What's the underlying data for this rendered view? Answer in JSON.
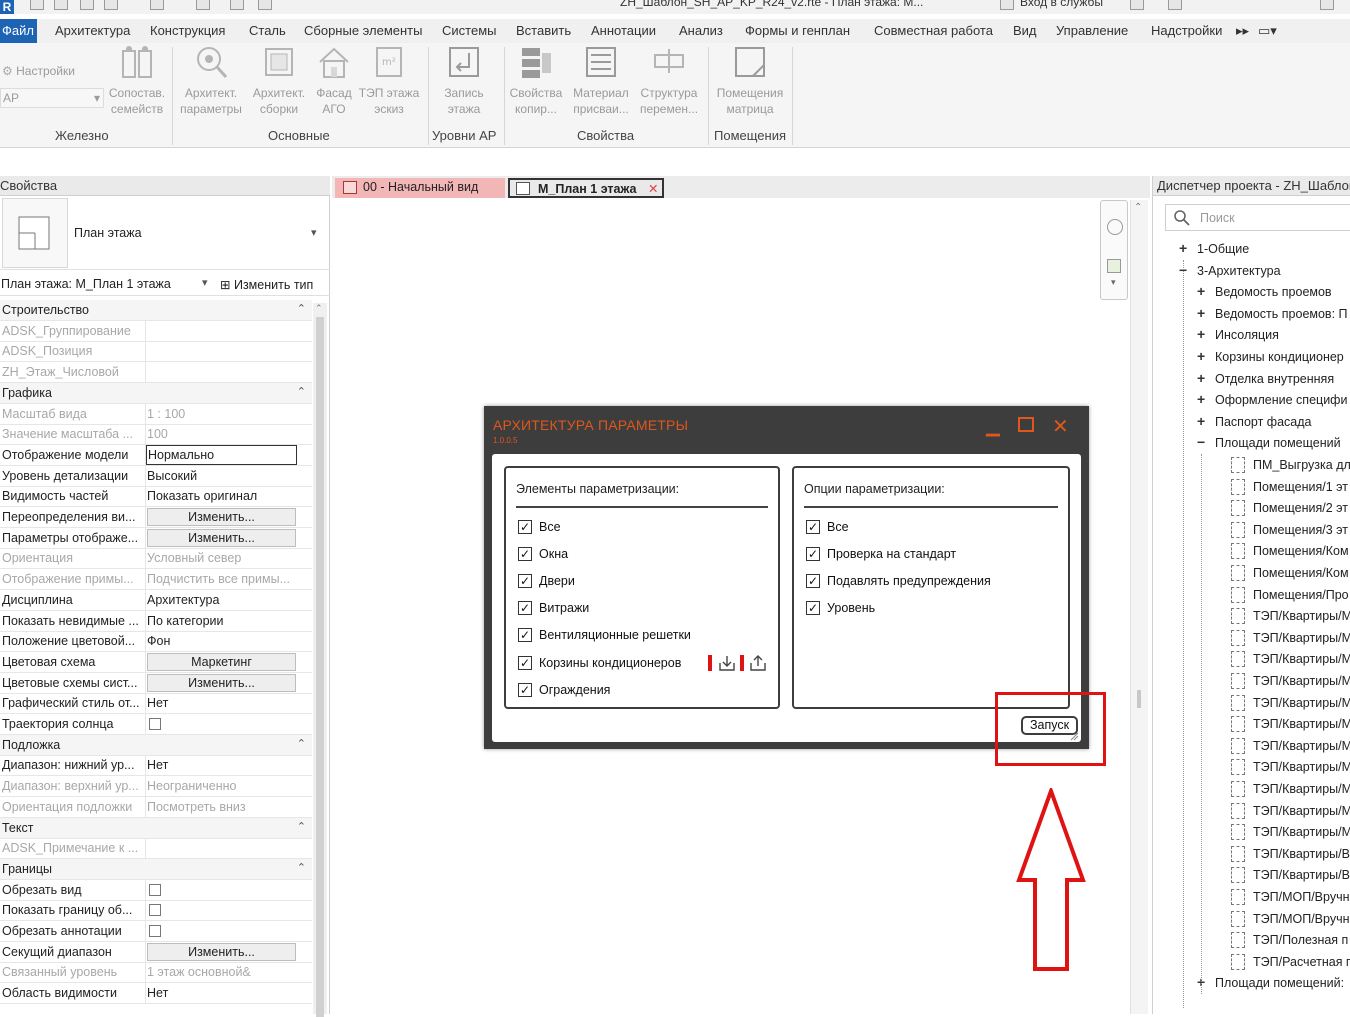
{
  "titlebar": {
    "app_letter": "R",
    "file_title": "ZH_Шаблон_SH_AP_KP_R24_v2.rte - План этажа: M...",
    "signin": "Вход в службы"
  },
  "menubar": {
    "file_label": "Файл",
    "items": [
      "Архитектура",
      "Конструкция",
      "Сталь",
      "Сборные элементы",
      "Системы",
      "Вставить",
      "Аннотации",
      "Анализ",
      "Формы и генплан",
      "Совместная работа",
      "Вид",
      "Управление",
      "Надстройки"
    ]
  },
  "ribbon": {
    "settings_label": "Настройки",
    "dropdown_value": "АР",
    "buttons": [
      {
        "line1": "Сопостав.",
        "line2": "семейств",
        "icon": "family-compare-icon"
      },
      {
        "line1": "Архитект.",
        "line2": "параметры",
        "icon": "arch-params-icon"
      },
      {
        "line1": "Архитект.",
        "line2": "сборки",
        "icon": "arch-assembly-icon"
      },
      {
        "line1": "Фасад",
        "line2": "АГО",
        "icon": "facade-icon"
      },
      {
        "line1": "ТЭП этажа",
        "line2": "эскиз",
        "icon": "tep-icon"
      },
      {
        "line1": "Запись",
        "line2": "этажа",
        "icon": "level-record-icon"
      },
      {
        "line1": "Свойства",
        "line2": "копир...",
        "icon": "properties-copy-icon"
      },
      {
        "line1": "Материал",
        "line2": "присваи...",
        "icon": "material-icon"
      },
      {
        "line1": "Структура",
        "line2": "перемен...",
        "icon": "structure-icon"
      },
      {
        "line1": "Помещения",
        "line2": "матрица",
        "icon": "rooms-matrix-icon"
      }
    ],
    "panels": [
      "Железно",
      "Основные",
      "Уровни АР",
      "Свойства",
      "Помещения"
    ]
  },
  "properties": {
    "title": "Свойства",
    "type_name": "План этажа",
    "instance_label": "План этажа: М_План 1 этажа",
    "edit_type_label": "Изменить тип",
    "rows": [
      {
        "kind": "group",
        "name": "Строительство"
      },
      {
        "kind": "dim",
        "name": "ADSK_Группирование",
        "value": ""
      },
      {
        "kind": "dim",
        "name": "ADSK_Позиция",
        "value": ""
      },
      {
        "kind": "dim",
        "name": "ZH_Этаж_Числовой",
        "value": ""
      },
      {
        "kind": "group",
        "name": "Графика"
      },
      {
        "kind": "dim",
        "name": "Масштаб вида",
        "value": "1 : 100"
      },
      {
        "kind": "dim",
        "name": "Значение масштаба ...",
        "value": "100"
      },
      {
        "kind": "input",
        "name": "Отображение модели",
        "value": "Нормально"
      },
      {
        "kind": "text",
        "name": "Уровень детализации",
        "value": "Высокий"
      },
      {
        "kind": "text",
        "name": "Видимость частей",
        "value": "Показать оригинал"
      },
      {
        "kind": "button",
        "name": "Переопределения ви...",
        "value": "Изменить..."
      },
      {
        "kind": "button",
        "name": "Параметры отображе...",
        "value": "Изменить..."
      },
      {
        "kind": "dim",
        "name": "Ориентация",
        "value": "Условный север"
      },
      {
        "kind": "dim",
        "name": "Отображение примы...",
        "value": "Подчистить все примы..."
      },
      {
        "kind": "text",
        "name": "Дисциплина",
        "value": "Архитектура"
      },
      {
        "kind": "text",
        "name": "Показать невидимые ...",
        "value": "По категории"
      },
      {
        "kind": "text",
        "name": "Положение цветовой...",
        "value": "Фон"
      },
      {
        "kind": "button",
        "name": "Цветовая схема",
        "value": "Маркетинг"
      },
      {
        "kind": "button",
        "name": "Цветовые схемы сист...",
        "value": "Изменить..."
      },
      {
        "kind": "text",
        "name": "Графический стиль от...",
        "value": "Нет"
      },
      {
        "kind": "check",
        "name": "Траектория солнца",
        "value": ""
      },
      {
        "kind": "group",
        "name": "Подложка"
      },
      {
        "kind": "text",
        "name": "Диапазон: нижний ур...",
        "value": "Нет"
      },
      {
        "kind": "dim",
        "name": "Диапазон: верхний ур...",
        "value": "Неограниченно"
      },
      {
        "kind": "dim",
        "name": "Ориентация подложки",
        "value": "Посмотреть вниз"
      },
      {
        "kind": "group",
        "name": "Текст"
      },
      {
        "kind": "dim",
        "name": "ADSK_Примечание к ...",
        "value": ""
      },
      {
        "kind": "group",
        "name": "Границы"
      },
      {
        "kind": "check",
        "name": "Обрезать вид",
        "value": ""
      },
      {
        "kind": "check",
        "name": "Показать границу об...",
        "value": ""
      },
      {
        "kind": "check",
        "name": "Обрезать аннотации",
        "value": ""
      },
      {
        "kind": "button",
        "name": "Секущий диапазон",
        "value": "Изменить..."
      },
      {
        "kind": "dim",
        "name": "Связанный уровень",
        "value": "1 этаж основной&"
      },
      {
        "kind": "text",
        "name": "Область видимости",
        "value": "Нет"
      }
    ]
  },
  "tabs": [
    {
      "label": "00 - Начальный вид",
      "active": false
    },
    {
      "label": "М_План 1 этажа",
      "active": true
    }
  ],
  "browser": {
    "title": "Диспетчер проекта - ZH_Шаблон",
    "search_placeholder": "Поиск",
    "tree": [
      {
        "level": 0,
        "sign": "+",
        "label": "1-Общие"
      },
      {
        "level": 0,
        "sign": "−",
        "label": "3-Архитектура"
      },
      {
        "level": 1,
        "sign": "+",
        "label": "Ведомость проемов"
      },
      {
        "level": 1,
        "sign": "+",
        "label": "Ведомость проемов: П"
      },
      {
        "level": 1,
        "sign": "+",
        "label": "Инсоляция"
      },
      {
        "level": 1,
        "sign": "+",
        "label": "Корзины кондиционер"
      },
      {
        "level": 1,
        "sign": "+",
        "label": "Отделка внутренняя"
      },
      {
        "level": 1,
        "sign": "+",
        "label": "Оформление специфи"
      },
      {
        "level": 1,
        "sign": "+",
        "label": "Паспорт фасада"
      },
      {
        "level": 1,
        "sign": "−",
        "label": "Площади помещений"
      },
      {
        "level": 2,
        "sign": "",
        "label": "ПМ_Выгрузка дл"
      },
      {
        "level": 2,
        "sign": "",
        "label": "Помещения/1 эт"
      },
      {
        "level": 2,
        "sign": "",
        "label": "Помещения/2 эт"
      },
      {
        "level": 2,
        "sign": "",
        "label": "Помещения/3 эт"
      },
      {
        "level": 2,
        "sign": "",
        "label": "Помещения/Ком"
      },
      {
        "level": 2,
        "sign": "",
        "label": "Помещения/Ком"
      },
      {
        "level": 2,
        "sign": "",
        "label": "Помещения/Про"
      },
      {
        "level": 2,
        "sign": "",
        "label": "ТЭП/Квартиры/М"
      },
      {
        "level": 2,
        "sign": "",
        "label": "ТЭП/Квартиры/М"
      },
      {
        "level": 2,
        "sign": "",
        "label": "ТЭП/Квартиры/М"
      },
      {
        "level": 2,
        "sign": "",
        "label": "ТЭП/Квартиры/М"
      },
      {
        "level": 2,
        "sign": "",
        "label": "ТЭП/Квартиры/М"
      },
      {
        "level": 2,
        "sign": "",
        "label": "ТЭП/Квартиры/М"
      },
      {
        "level": 2,
        "sign": "",
        "label": "ТЭП/Квартиры/М"
      },
      {
        "level": 2,
        "sign": "",
        "label": "ТЭП/Квартиры/М"
      },
      {
        "level": 2,
        "sign": "",
        "label": "ТЭП/Квартиры/М"
      },
      {
        "level": 2,
        "sign": "",
        "label": "ТЭП/Квартиры/М"
      },
      {
        "level": 2,
        "sign": "",
        "label": "ТЭП/Квартиры/М"
      },
      {
        "level": 2,
        "sign": "",
        "label": "ТЭП/Квартиры/В"
      },
      {
        "level": 2,
        "sign": "",
        "label": "ТЭП/Квартиры/В"
      },
      {
        "level": 2,
        "sign": "",
        "label": "ТЭП/МОП/Вручн"
      },
      {
        "level": 2,
        "sign": "",
        "label": "ТЭП/МОП/Вручн"
      },
      {
        "level": 2,
        "sign": "",
        "label": "ТЭП/Полезная п"
      },
      {
        "level": 2,
        "sign": "",
        "label": "ТЭП/Расчетная п"
      },
      {
        "level": 1,
        "sign": "+",
        "label": "Площади помещений:"
      }
    ]
  },
  "dialog": {
    "title": "АРХИТЕКТУРА ПАРАМЕТРЫ",
    "version": "1.0.0.5",
    "left_group": {
      "title": "Элементы параметризации:",
      "items": [
        "Все",
        "Окна",
        "Двери",
        "Витражи",
        "Вентиляционные решетки",
        "Корзины кондиционеров",
        "Ограждения"
      ]
    },
    "right_group": {
      "title": "Опции параметризации:",
      "items": [
        "Все",
        "Проверка на стандарт",
        "Подавлять предупреждения",
        "Уровень"
      ]
    },
    "run_label": "Запуск",
    "accent_color": "#e0571b"
  },
  "annotation_color": "#e01313"
}
